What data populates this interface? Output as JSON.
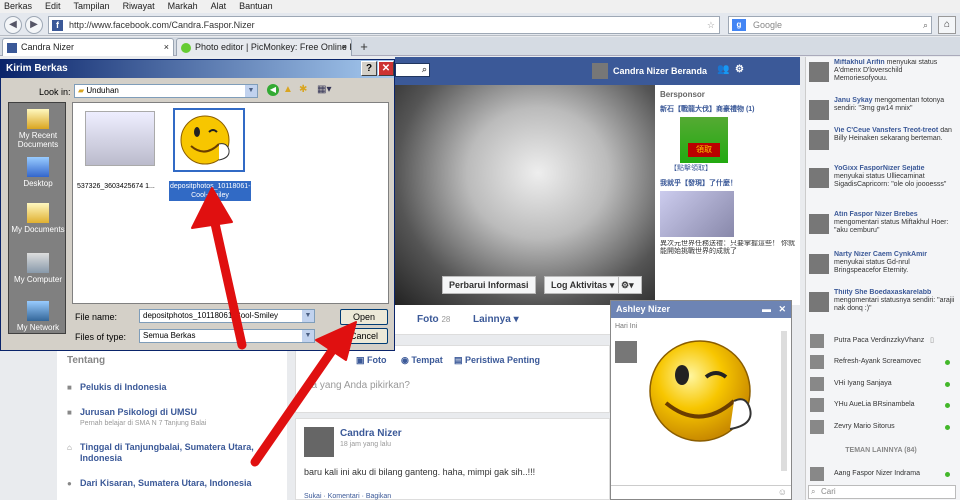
{
  "menu": [
    "Berkas",
    "Edit",
    "Tampilan",
    "Riwayat",
    "Markah",
    "Alat",
    "Bantuan"
  ],
  "browser": {
    "url": "http://www.facebook.com/Candra.Faspor.Nizer",
    "search_placeholder": "Google"
  },
  "tabs": [
    {
      "label": "Candra Nizer"
    },
    {
      "label": "Photo editor | PicMonkey: Free Online Ph..."
    }
  ],
  "fb": {
    "user_name": "Candra Nizer",
    "home_label": "Beranda",
    "cover_buttons": [
      "Perbarui Informasi",
      "Log Aktivitas"
    ],
    "sponsor_title": "Bersponsor",
    "sponsor_ad1": "新石【戰龍大伐】商豪禮物 (1)",
    "sponsor_ad1_btn": "領取",
    "sponsor_ad1_link": "【點擊領取】",
    "sponsor_ad2": "我就乎【發現】了什麼！",
    "sponsor_ad2_text": "異次元世界任務送禮：只要掌握這些！ 你就能開始挑戰世界的成就了",
    "profile_tabs": [
      {
        "label": "Foto",
        "count": "28"
      },
      {
        "label": "Lainnya"
      }
    ],
    "left_title": "Tentang",
    "about": [
      {
        "text": "Pelukis di Indonesia",
        "sub": ""
      },
      {
        "text": "Jurusan Psikologi di UMSU",
        "sub": "Pernah belajar di SMA N 7 Tanjung Balai"
      },
      {
        "text": "Tinggal di Tanjungbalai, Sumatera Utara, Indonesia",
        "sub": ""
      },
      {
        "text": "Dari Kisaran, Sumatera Utara, Indonesia",
        "sub": ""
      }
    ],
    "composer_tabs": [
      "Foto",
      "Tempat",
      "Peristiwa Penting"
    ],
    "composer_placeholder": "pa yang Anda pikirkan?",
    "post": {
      "author": "Candra Nizer",
      "time": "18 jam yang lalu",
      "text": "baru kali ini aku di bilang ganteng. haha, mimpi gak sih..!!!",
      "footer": "Sukai · Komentari · Bagikan"
    }
  },
  "ticker": [
    {
      "name": "Miftakhul Arifin",
      "text": "menyukai status A'dmenx D'loverschild Memoriesofyouu."
    },
    {
      "name": "Janu Sykay",
      "text": "mengomentari fotonya sendiri: \"3mg gw14 mnix\""
    },
    {
      "name": "Vie C'Ceue Vansfers Treot-treot",
      "text": "dan Billy Heinaken sekarang berteman."
    },
    {
      "name": "YoGixx FasporNizer Sejatie",
      "text": "menyukai status Ulliecaminat SigadisCapricorn: \"ole olo joooesss\""
    },
    {
      "name": "Atin Faspor Nizer Brebes",
      "text": "mengomentari status Miftakhul Hoer: \"aku cemburu\""
    },
    {
      "name": "Narty Nizer Caem CynkAmir",
      "text": "menyukai status Gd-nrul Bringspeacefor Eternity."
    },
    {
      "name": "Thiity She Boedaxaskarelabb",
      "text": "mengomentari statusnya sendiri: \"arajii nak donq :)\""
    }
  ],
  "online": [
    {
      "name": "Putra Paca VerdinzzkyVhanz"
    },
    {
      "name": "Refresh-Ayank Screamovec"
    },
    {
      "name": "VHi Iyang Sanjaya"
    },
    {
      "name": "YHu AueLia BRsinambela"
    },
    {
      "name": "Zevry Mario Sitorus"
    }
  ],
  "online_header": "TEMAN LAINNYA (84)",
  "online_more": [
    {
      "name": "Aang Faspor Nizer Indrama"
    }
  ],
  "chat_search": "Cari",
  "chatwin": {
    "name": "Ashley Nizer",
    "day": "Hari Ini"
  },
  "dialog": {
    "title": "Kirim Berkas",
    "look_in_label": "Look in:",
    "look_in_value": "Unduhan",
    "places": [
      "My Recent Documents",
      "Desktop",
      "My Documents",
      "My Computer",
      "My Network"
    ],
    "files": [
      {
        "name": "537326_3603425674 1..."
      },
      {
        "name": "depositphotos_10118061-Cool-Smiley"
      }
    ],
    "filename_label": "File name:",
    "filename_value": "depositphotos_10118061-Cool-Smiley",
    "filetype_label": "Files of type:",
    "filetype_value": "Semua Berkas",
    "open": "Open",
    "cancel": "Cancel"
  },
  "colors": {
    "fb_blue": "#3b5998",
    "xp_title": "#0a246a",
    "arrow": "#e01010",
    "smiley": "#f7c600"
  }
}
